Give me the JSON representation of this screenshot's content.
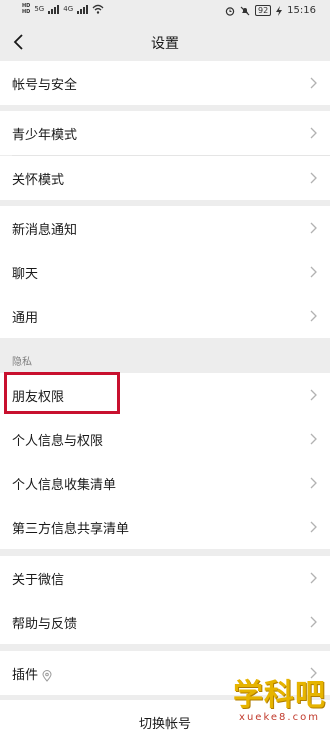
{
  "status_bar": {
    "sim1": "HD",
    "sim2": "HD",
    "net1": "5G",
    "net2": "4G",
    "battery": "92",
    "time": "15:16"
  },
  "header": {
    "title": "设置"
  },
  "groups": [
    {
      "items": [
        {
          "label": "帐号与安全"
        }
      ]
    },
    {
      "items": [
        {
          "label": "青少年模式"
        },
        {
          "label": "关怀模式"
        }
      ]
    },
    {
      "items": [
        {
          "label": "新消息通知"
        },
        {
          "label": "聊天"
        },
        {
          "label": "通用"
        }
      ]
    },
    {
      "title": "隐私",
      "items": [
        {
          "label": "朋友权限"
        },
        {
          "label": "个人信息与权限"
        },
        {
          "label": "个人信息收集清单"
        },
        {
          "label": "第三方信息共享清单"
        }
      ]
    },
    {
      "items": [
        {
          "label": "关于微信"
        },
        {
          "label": "帮助与反馈"
        }
      ]
    },
    {
      "items": [
        {
          "label": "插件"
        }
      ]
    }
  ],
  "footer": {
    "switch_account": "切换帐号"
  },
  "watermark": {
    "main": "学科吧",
    "sub": "xueke8.com"
  },
  "colors": {
    "highlight": "#c8102e",
    "background": "#ededed"
  }
}
